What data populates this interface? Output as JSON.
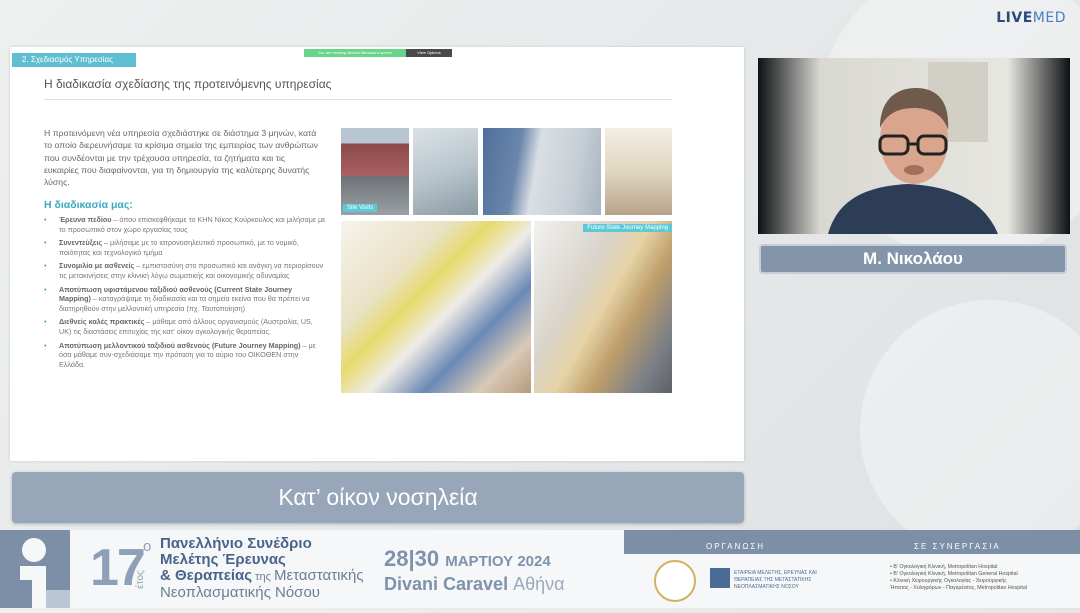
{
  "brand": {
    "live": "LIVE",
    "med": "MED"
  },
  "slide": {
    "section_tab": "2. Σχεδιασμός Υπηρεσίας",
    "share_notice": "You are viewing Michail Nikolaou's screen",
    "view_options": "View Options",
    "title": "Η διαδικασία σχεδίασης της προτεινόμενης υπηρεσίας",
    "intro": "Η προτεινόμενη νέα υπηρεσία σχεδιάστηκε σε διάστημα 3 μηνών, κατά το οποίο διερευνήσαμε τα κρίσιμα σημεία της εμπειρίας των ανθρώπων που συνδέονται με την τρέχουσα υπηρεσία, τα ζητήματα και τις ευκαιρίες που διαφαίνονται, για τη δημιουργία της καλύτερης δυνατής λύσης.",
    "process_heading": "Η διαδικασία μας:",
    "steps": [
      {
        "bold": "Έρευνα πεδίου",
        "text": " – όπου επισκεφθήκαμε το ΚΗΝ Νίκος Κούρκουλος και μιλήσαμε με το προσωπικό στον χώρο εργασίας τους"
      },
      {
        "bold": "Συνεντεύξεις",
        "text": " – μιλήσαμε με το ιατρονοσηλευτικό προσωπικό, με το νομικό, ποιότητας και τεχνολογικό τμήμα"
      },
      {
        "bold": "Συνομιλία με ασθενείς",
        "text": " – εμπιστοσύνη στο προσωπικό και ανάγκη να περιορίσουν τις μετακινήσεις στην κλινική λόγω σωματικής και οικονομικής αδυναμίας"
      },
      {
        "bold": "Αποτύπωση υφιστάμενου ταξιδιού ασθενούς (Current State Journey Mapping)",
        "text": " – καταγράψαμε τη διαδικασία και τα σημεία εκείνα που θα πρέπει να διατηρηθούν στην μελλοντική υπηρεσία (πχ. Ταυτοποίηση)"
      },
      {
        "bold": "Διεθνείς καλές πρακτικές",
        "text": " – μάθαμε από άλλους οργανισμούς (Αυστραλία, US, UK) τις διαστάσεις επιτυχίας της κατ' οίκον ογκολογικής θεραπείας."
      },
      {
        "bold": "Αποτύπωση μελλοντικού ταξιδιού ασθενούς (Future Journey Mapping)",
        "text": " – με όσα μάθαμε συν-σχεδιάσαμε την πρόταση για το αύριο του ΟΙΚΟΘΕΝ στην Ελλάδα."
      }
    ],
    "photo_caption_site": "Site Visits",
    "photo_caption_future": "Future State Journey Mapping"
  },
  "caption": "Κατ’ οίκον νοσηλεία",
  "speaker": {
    "name": "Μ. Νικολάου"
  },
  "footer": {
    "number": "17",
    "number_sup": "ο",
    "etos": "έτος",
    "congress_lines": [
      "Πανελλήνιο Συνέδριο",
      "Μελέτης Έρευνας",
      "& Θεραπείας"
    ],
    "congress_of": " της ",
    "congress_meta": "Μεταστατικής",
    "congress_last": "Νεοπλασματικής Νόσου",
    "days": "28|30",
    "month_year": "ΜΑΡΤΙΟΥ 2024",
    "venue": "Divani Caravel",
    "city": "Αθήνα",
    "organizer_label": "ΟΡΓΑΝΩΣΗ",
    "collab_label": "ΣΕ ΣΥΝΕΡΓΑΣΙΑ",
    "org_text": "ΕΤΑΙΡΕΙΑ ΜΕΛΕΤΗΣ, ΕΡΕΥΝΑΣ ΚΑΙ ΘΕΡΑΠΕΙΑΣ ΤΗΣ ΜΕΤΑΣΤΑΤΙΚΗΣ ΝΕΟΠΛΑΣΜΑΤΙΚΗΣ ΝΟΣΟΥ",
    "partners": [
      "• Β' Ογκολογική Κλινική, Metropolitan Hospital",
      "• Β' Ογκολογική Κλινική, Metropolitan General Hospital",
      "• Κλινική Χειρουργικής Ογκολογίας - Χειρουργικής",
      "Ήπατος - Χοληφόρων - Παγκρέατος, Metropolitan Hospital"
    ]
  }
}
